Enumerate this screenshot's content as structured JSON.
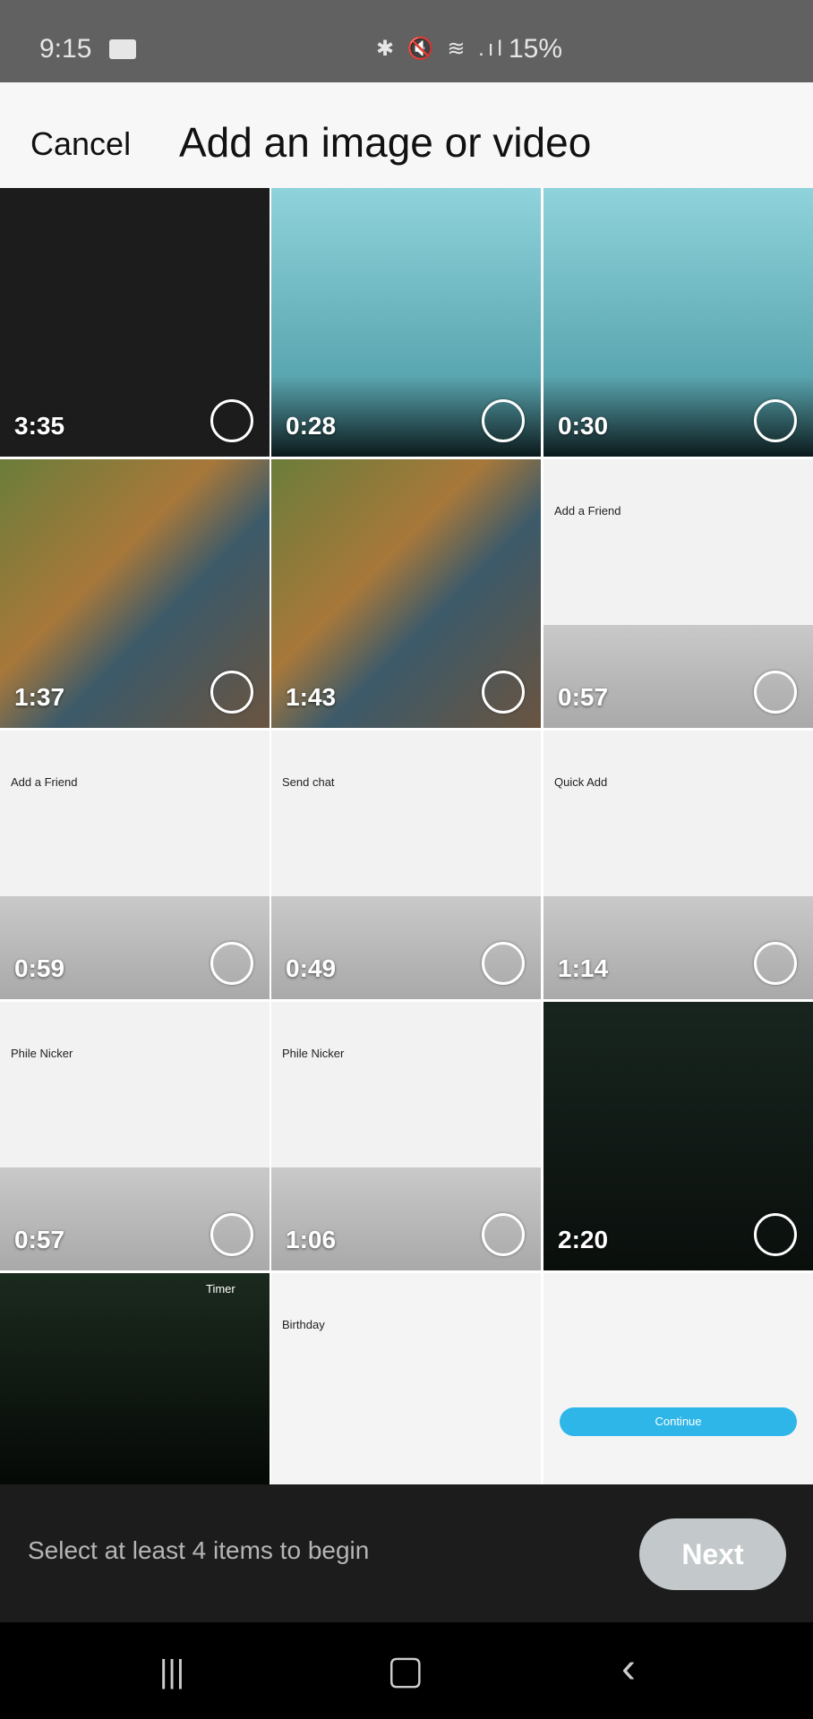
{
  "status_bar": {
    "time": "9:15",
    "icons": "✱ 🔇 ≋ .ıl",
    "battery": "15%"
  },
  "header": {
    "cancel_label": "Cancel",
    "title": "Add an image or video"
  },
  "tiles": [
    {
      "duration": "3:35",
      "bg": "#1c1c1c"
    },
    {
      "duration": "0:28",
      "bg": "linear-gradient(#8fd3dc,#5aa6b0 70%,#0b1a1c)"
    },
    {
      "duration": "0:30",
      "bg": "linear-gradient(#8fd3dc,#5aa6b0 70%,#0b1a1c)"
    },
    {
      "duration": "1:37",
      "bg": "linear-gradient(135deg,#6b7d3a,#a7783a 40%,#3c5a6a 60%,#6a5440)"
    },
    {
      "duration": "1:43",
      "bg": "linear-gradient(135deg,#6b7d3a,#a7783a 40%,#3c5a6a 60%,#6a5440)"
    },
    {
      "duration": "0:57",
      "bg": "#f2f2f2",
      "text": "Add a Friend"
    },
    {
      "duration": "0:59",
      "bg": "#f2f2f2",
      "text": "Add a Friend"
    },
    {
      "duration": "0:49",
      "bg": "#f2f2f2",
      "text": "Send chat"
    },
    {
      "duration": "1:14",
      "bg": "#f2f2f2",
      "text": "Quick Add"
    },
    {
      "duration": "0:57",
      "bg": "#f2f2f2",
      "text": "Phile Nicker"
    },
    {
      "duration": "1:06",
      "bg": "#f2f2f2",
      "text": "Phile Nicker"
    },
    {
      "duration": "2:20",
      "bg": "linear-gradient(#18251f,#0a0f0c)"
    },
    {
      "duration": "",
      "bg": "linear-gradient(#1b2a1e,#000)",
      "text": "Timer"
    },
    {
      "duration": "",
      "bg": "#f4f4f4",
      "text": "Birthday"
    },
    {
      "duration": "",
      "bg": "#f4f4f4",
      "text": "Continue"
    }
  ],
  "footer": {
    "hint": "Select at least 4 items to begin",
    "next_label": "Next"
  },
  "nav_bar": {
    "recents": "|||",
    "home": "▢",
    "back": "‹"
  }
}
